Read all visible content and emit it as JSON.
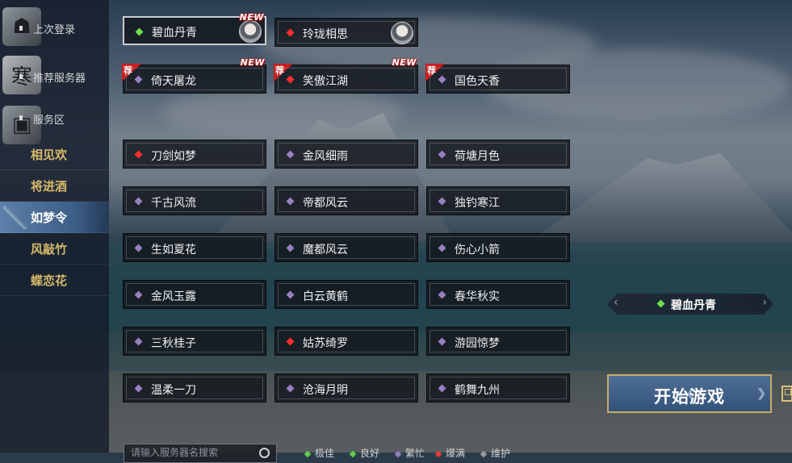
{
  "sidebar": {
    "system_items": [
      {
        "label": "上次登录",
        "icon": "portrait-icon"
      },
      {
        "label": "推荐服务器",
        "icon": "calligraphy-icon"
      },
      {
        "label": "服务区",
        "icon": "film-icon"
      }
    ],
    "zones": [
      {
        "label": "相见欢",
        "active": false
      },
      {
        "label": "将进酒",
        "active": false
      },
      {
        "label": "如梦令",
        "active": true
      },
      {
        "label": "风敲竹",
        "active": false
      },
      {
        "label": "蝶恋花",
        "active": false
      }
    ]
  },
  "servers": {
    "recent": [
      {
        "name": "碧血丹青",
        "status": "green",
        "new": true,
        "avatar": true,
        "selected": true
      },
      {
        "name": "玲珑相思",
        "status": "red",
        "new": false,
        "avatar": true,
        "selected": false
      }
    ],
    "recommended": [
      {
        "name": "倚天屠龙",
        "status": "purple",
        "new": true,
        "rec": true
      },
      {
        "name": "笑傲江湖",
        "status": "red",
        "new": true,
        "rec": true
      },
      {
        "name": "国色天香",
        "status": "purple",
        "new": false,
        "rec": true
      }
    ],
    "zone_list": [
      {
        "name": "刀剑如梦",
        "status": "red"
      },
      {
        "name": "金风细雨",
        "status": "purple"
      },
      {
        "name": "荷塘月色",
        "status": "purple"
      },
      {
        "name": "千古风流",
        "status": "purple"
      },
      {
        "name": "帝都风云",
        "status": "purple"
      },
      {
        "name": "独钓寒江",
        "status": "purple"
      },
      {
        "name": "生如夏花",
        "status": "purple"
      },
      {
        "name": "魔都风云",
        "status": "purple"
      },
      {
        "name": "伤心小箭",
        "status": "purple"
      },
      {
        "name": "金风玉露",
        "status": "purple"
      },
      {
        "name": "白云黄鹤",
        "status": "purple"
      },
      {
        "name": "春华秋实",
        "status": "purple"
      },
      {
        "name": "三秋桂子",
        "status": "purple"
      },
      {
        "name": "姑苏绮罗",
        "status": "red"
      },
      {
        "name": "游园惊梦",
        "status": "purple"
      },
      {
        "name": "温柔一刀",
        "status": "purple"
      },
      {
        "name": "沧海月明",
        "status": "purple"
      },
      {
        "name": "鹤舞九州",
        "status": "purple"
      }
    ],
    "new_badge": "NEW",
    "rec_badge": "荐"
  },
  "selected_server": {
    "name": "碧血丹青",
    "left_arrow": "‹",
    "right_arrow": "›"
  },
  "start_button": {
    "label": "开始游戏"
  },
  "search": {
    "placeholder": "请输入服务器名搜索"
  },
  "legend": [
    {
      "label": "极佳",
      "color": "#5fd04a"
    },
    {
      "label": "良好",
      "color": "#5fd04a"
    },
    {
      "label": "繁忙",
      "color": "#9a7fc4"
    },
    {
      "label": "爆满",
      "color": "#e53935"
    },
    {
      "label": "维护",
      "color": "#9a9a9a"
    }
  ],
  "status_colors": {
    "green": "#6ce04a",
    "red": "#ff2d2d",
    "purple": "#9a7fc4"
  }
}
